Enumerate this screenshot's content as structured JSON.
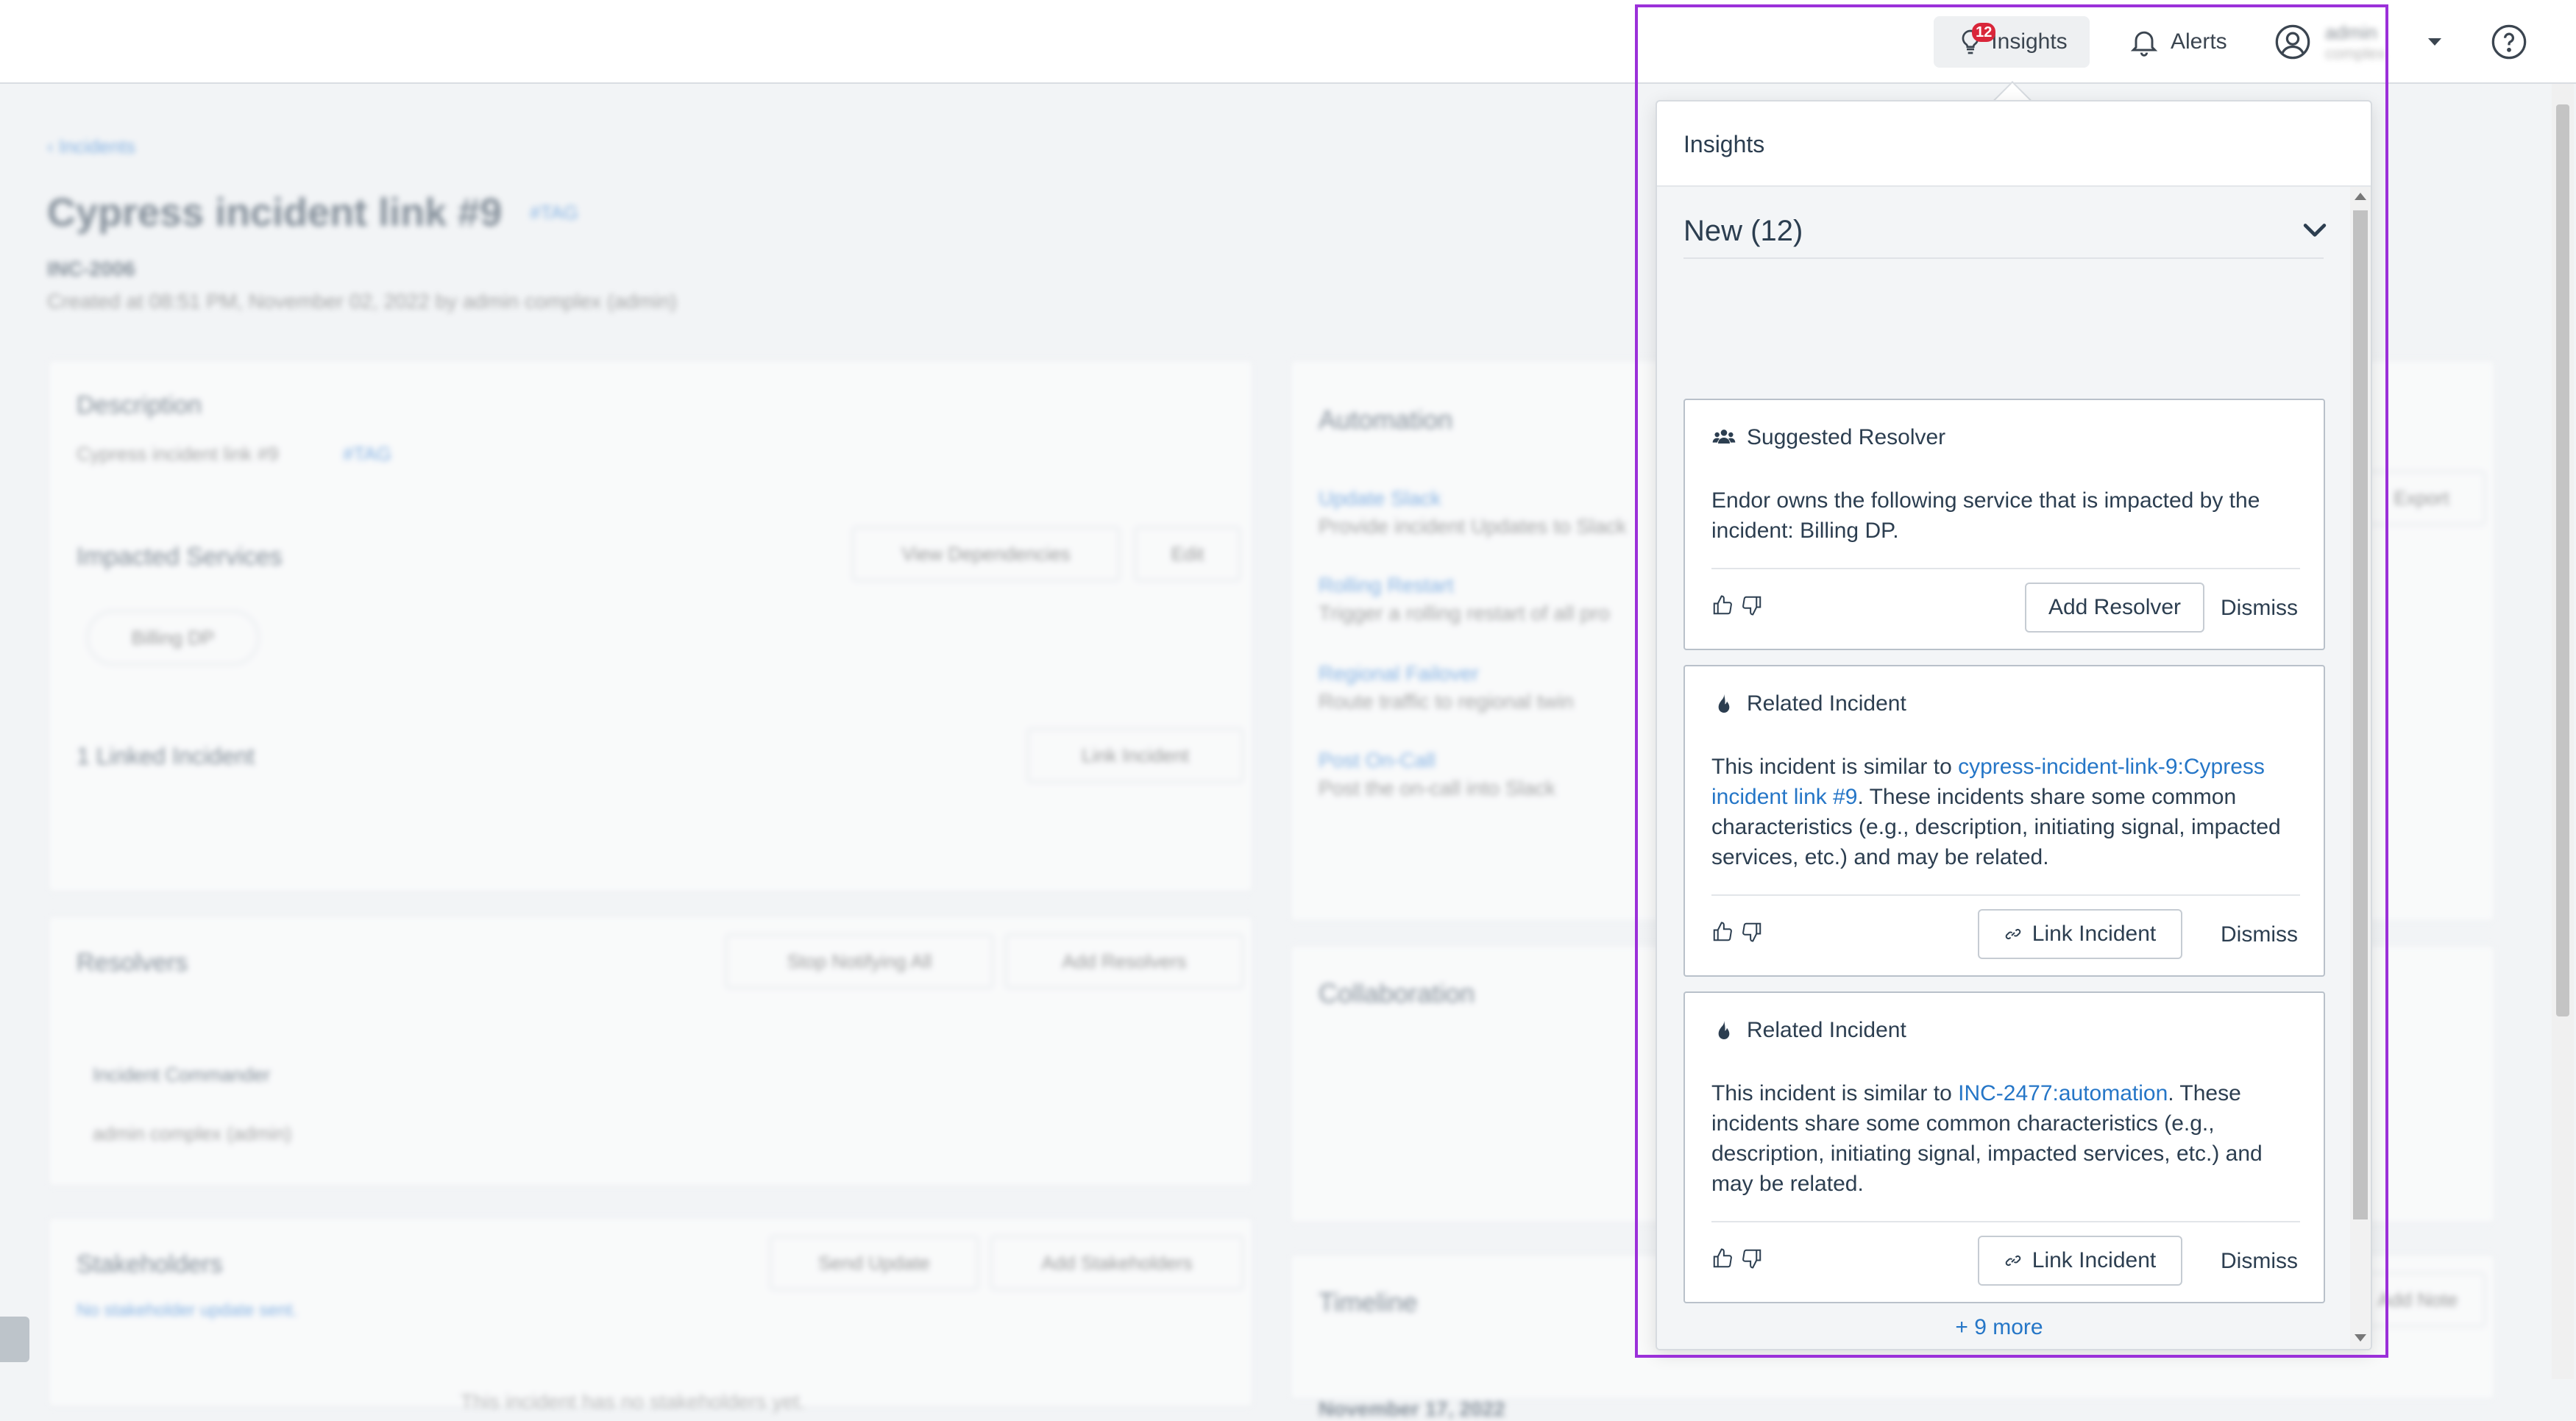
{
  "topbar": {
    "insights_label": "Insights",
    "insights_badge": "12",
    "alerts_label": "Alerts",
    "user_name": "admin",
    "user_org": "complex",
    "help_icon": "help-circle-icon"
  },
  "background": {
    "breadcrumb": "‹ Incidents",
    "incident_title": "Cypress incident link #9",
    "incident_tag": "#TAG",
    "incident_id": "INC-2006",
    "created_line": "Created at 08:51 PM, November 02, 2022 by admin complex (admin)",
    "export_button": "Export",
    "description_title": "Description",
    "description_text": "Cypress incident link #9",
    "description_tag": "#TAG",
    "impacted_title": "Impacted Services",
    "view_dependencies": "View Dependencies",
    "edit": "Edit",
    "service_chip": "Billing DP",
    "linked_incident": "1 Linked Incident",
    "link_incident": "Link Incident",
    "resolvers_title": "Resolvers",
    "stop_notifying": "Stop Notifying All",
    "add_resolvers": "Add Resolvers",
    "commander_header": "Incident Commander",
    "commander_name": "admin complex (admin)",
    "stakeholders_title": "Stakeholders",
    "send_update": "Send Update",
    "add_stakeholders": "Add Stakeholders",
    "no_stakeholder_updates": "No stakeholder update sent.",
    "no_stakeholders": "This incident has no stakeholders yet.",
    "automation_title": "Automation",
    "automation_items": [
      {
        "name": "Update Slack",
        "desc": "Provide incident Updates to Slack"
      },
      {
        "name": "Rolling Restart",
        "desc": "Trigger a rolling restart of all pro"
      },
      {
        "name": "Regional Failover",
        "desc": "Route traffic to regional twin"
      },
      {
        "name": "Post On-Call",
        "desc": "Post the on-call into Slack"
      }
    ],
    "collaboration_title": "Collaboration",
    "timeline_title": "Timeline",
    "timeline_date": "November 17, 2022",
    "add_note": "Add Note"
  },
  "panel": {
    "title": "Insights",
    "section_title": "New (12)",
    "insights": [
      {
        "type": "Suggested Resolver",
        "icon": "users-icon",
        "text_before": "Endor owns the following service that is impacted by the incident: Billing DP.",
        "link": "",
        "text_after": "",
        "action": "Add Resolver",
        "dismiss": "Dismiss"
      },
      {
        "type": "Related Incident",
        "icon": "flame-icon",
        "text_before": "This incident is similar to ",
        "link": "cypress-incident-link-9:Cypress incident link #9",
        "text_after": ". These incidents share some common characteristics (e.g., description, initiating signal, impacted services, etc.) and may be related.",
        "action": "Link Incident",
        "dismiss": "Dismiss"
      },
      {
        "type": "Related Incident",
        "icon": "flame-icon",
        "text_before": "This incident is similar to ",
        "link": "INC-2477:automation",
        "text_after": ". These incidents share some common characteristics (e.g., description, initiating signal, impacted services, etc.) and may be related.",
        "action": "Link Incident",
        "dismiss": "Dismiss"
      }
    ],
    "more_link": "+ 9 more"
  },
  "colors": {
    "accent_link": "#2576c7",
    "badge": "#d9263a",
    "highlight_frame": "#9b30d9"
  }
}
